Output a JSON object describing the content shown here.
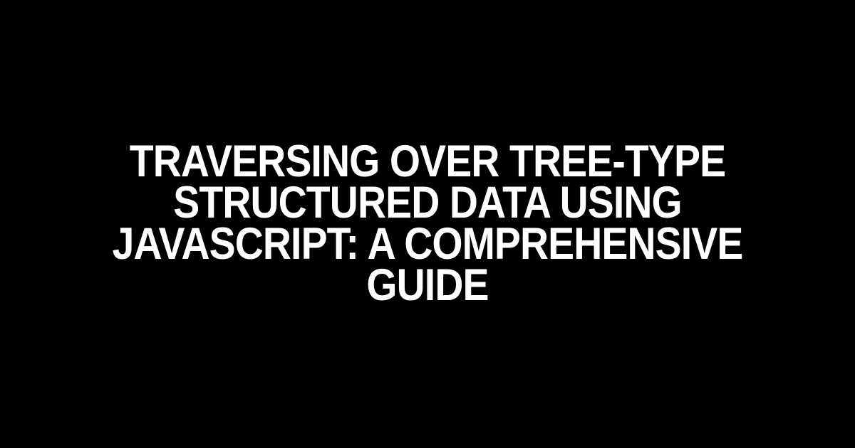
{
  "document": {
    "title": "Traversing Over Tree-Type Structured Data Using JavaScript: A Comprehensive Guide"
  }
}
